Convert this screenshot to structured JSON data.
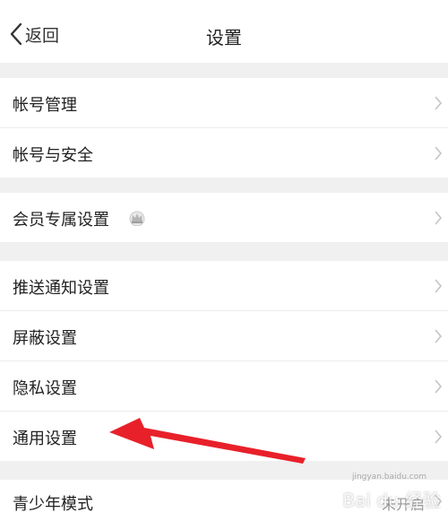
{
  "header": {
    "back_label": "返回",
    "title": "设置"
  },
  "groups": [
    {
      "items": [
        {
          "label": "帐号管理"
        },
        {
          "label": "帐号与安全"
        }
      ]
    },
    {
      "items": [
        {
          "label": "会员专属设置",
          "icon": "crown-icon"
        }
      ]
    },
    {
      "items": [
        {
          "label": "推送通知设置"
        },
        {
          "label": "屏蔽设置"
        },
        {
          "label": "隐私设置"
        },
        {
          "label": "通用设置"
        }
      ]
    },
    {
      "items": [
        {
          "label": "青少年模式",
          "status": "未开启"
        }
      ]
    }
  ],
  "annotation": {
    "color": "#e8202a"
  },
  "watermark": {
    "text": "Bai du 经验",
    "sub": "jingyan.baidu.com"
  }
}
